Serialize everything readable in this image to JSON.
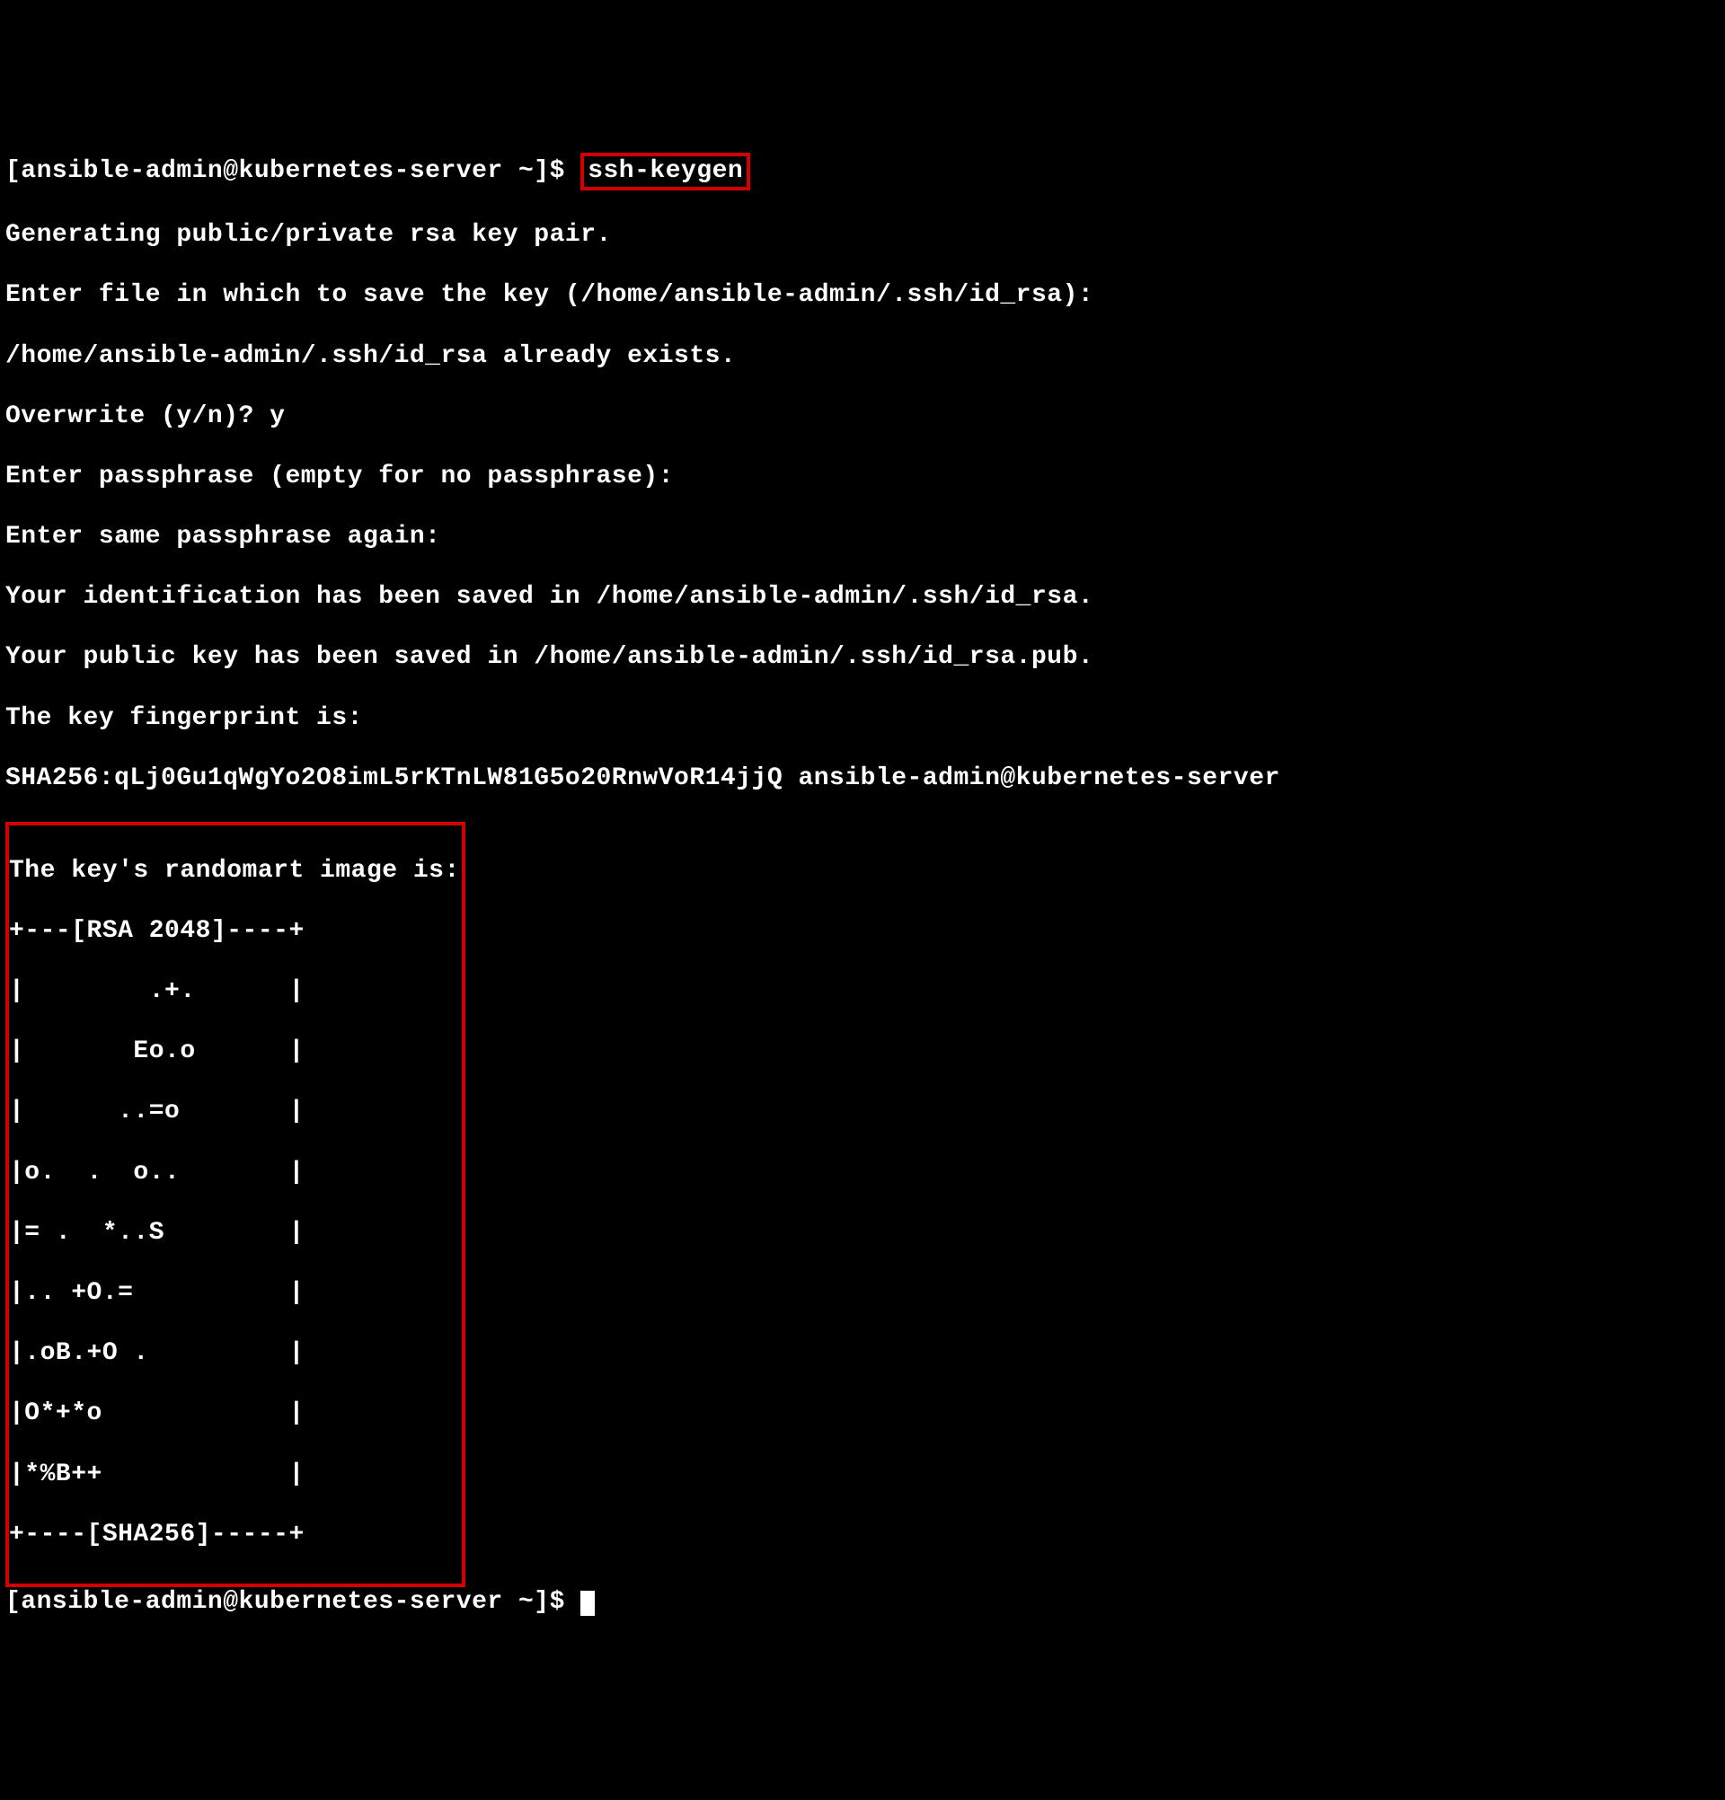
{
  "prompt1_prefix": "[ansible-admin@kubernetes-server ~]$ ",
  "command": "ssh-keygen",
  "out_generating": "Generating public/private rsa key pair.",
  "out_enterfile": "Enter file in which to save the key (/home/ansible-admin/.ssh/id_rsa):",
  "out_exists": "/home/ansible-admin/.ssh/id_rsa already exists.",
  "out_overwrite": "Overwrite (y/n)? y",
  "out_pass1": "Enter passphrase (empty for no passphrase):",
  "out_pass2": "Enter same passphrase again:",
  "out_id_saved": "Your identification has been saved in /home/ansible-admin/.ssh/id_rsa.",
  "out_pub_saved": "Your public key has been saved in /home/ansible-admin/.ssh/id_rsa.pub.",
  "out_fp_label": "The key fingerprint is:",
  "out_fp_value": "SHA256:qLj0Gu1qWgYo2O8imL5rKTnLW81G5o20RnwVoR14jjQ ansible-admin@kubernetes-server",
  "randomart_header": "The key's randomart image is:",
  "randomart_top": "+---[RSA 2048]----+",
  "randomart_l1": "|        .+.      |",
  "randomart_l2": "|       Eo.o      |",
  "randomart_l3": "|      ..=o       |",
  "randomart_l4": "|o.  .  o..       |",
  "randomart_l5": "|= .  *..S        |",
  "randomart_l6": "|.. +O.=          |",
  "randomart_l7": "|.oB.+O .         |",
  "randomart_l8": "|O*+*o            |",
  "randomart_l9": "|*%B++            |",
  "randomart_bottom": "+----[SHA256]-----+",
  "prompt2": "[ansible-admin@kubernetes-server ~]$ "
}
